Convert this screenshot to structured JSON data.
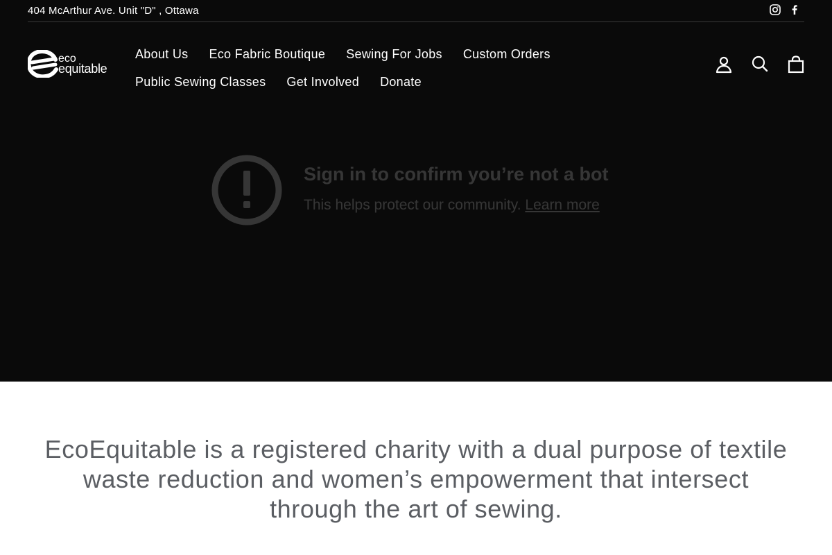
{
  "topbar": {
    "address": "404 McArthur Ave. Unit \"D\" , Ottawa",
    "social": [
      "instagram-icon",
      "facebook-icon"
    ]
  },
  "logo": {
    "line1": "eco",
    "line2": "equitable"
  },
  "nav": {
    "row1": [
      "About Us",
      "Eco Fabric Boutique",
      "Sewing For Jobs",
      "Custom Orders"
    ],
    "row2": [
      "Public Sewing Classes",
      "Get Involved",
      "Donate"
    ]
  },
  "header_icons": [
    "account-icon",
    "search-icon",
    "cart-icon"
  ],
  "video_embed": {
    "title": "Sign in to confirm you’re not a bot",
    "subtitle": "This helps protect our community.",
    "link": "Learn more"
  },
  "mission": {
    "text": "EcoEquitable is a registered charity with a dual purpose of textile waste reduction and women’s empowerment that intersect through the art of sewing."
  },
  "colors": {
    "hero_bg": "#0a0a0a",
    "mission_text": "#5b5e63",
    "nav_text": "#ffffff"
  }
}
